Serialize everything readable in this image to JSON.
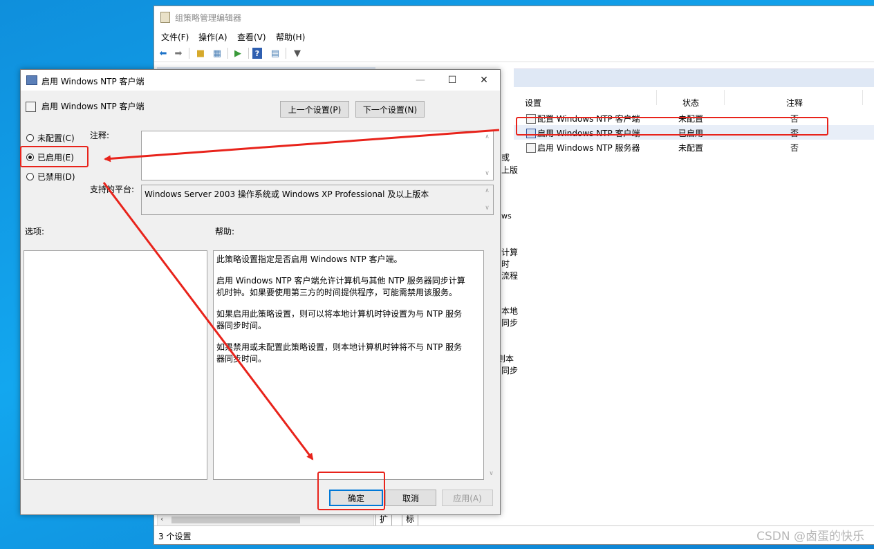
{
  "editor": {
    "title": "组策略管理编辑器",
    "menu": [
      "文件(F)",
      "操作(A)",
      "查看(V)",
      "帮助(H)"
    ],
    "columns": {
      "setting": "设置",
      "state": "状态",
      "comment": "注释"
    },
    "rows": [
      {
        "name": "配置 Windows NTP 客户端",
        "state": "未配置",
        "comment": "否"
      },
      {
        "name": "启用 Windows NTP 客户端",
        "state": "已启用",
        "comment": "否"
      },
      {
        "name": "启用 Windows NTP 服务器",
        "state": "未配置",
        "comment": "否"
      }
    ],
    "peek_texts": [
      "或",
      "上版",
      "ws",
      "计算",
      "时",
      "流程",
      "本地",
      "同步",
      "则本",
      "同步"
    ],
    "tabs": {
      "extended": "扩展",
      "standard": "标准"
    },
    "status": "3 个设置"
  },
  "dialog": {
    "title": "启用 Windows NTP 客户端",
    "subtitle": "启用 Windows NTP 客户端",
    "prev_button": "上一个设置(P)",
    "next_button": "下一个设置(N)",
    "radio": {
      "not_configured": "未配置(C)",
      "enabled": "已启用(E)",
      "disabled": "已禁用(D)",
      "selected": "enabled"
    },
    "comment_label": "注释:",
    "comment_value": "",
    "platform_label": "支持的平台:",
    "platform_value": "Windows Server 2003 操作系统或 Windows XP Professional 及以上版本",
    "options_label": "选项:",
    "help_label": "帮助:",
    "help": [
      "此策略设置指定是否启用 Windows NTP 客户端。",
      "启用 Windows NTP 客户端允许计算机与其他 NTP 服务器同步计算机时钟。如果要使用第三方的时间提供程序，可能需禁用该服务。",
      "如果启用此策略设置，则可以将本地计算机时钟设置为与 NTP 服务器同步时间。",
      "如果禁用或未配置此策略设置，则本地计算机时钟将不与 NTP 服务器同步时间。"
    ],
    "ok": "确定",
    "cancel": "取消",
    "apply": "应用(A)"
  },
  "annotation_color": "#e8231b",
  "watermark": "CSDN @卤蛋的快乐"
}
